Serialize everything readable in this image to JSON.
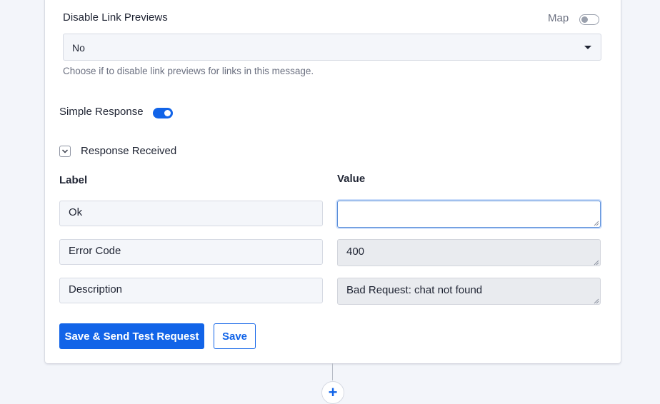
{
  "disable_link_previews": {
    "title": "Disable Link Previews",
    "map_label": "Map",
    "map_toggle_on": false,
    "selected": "No",
    "help": "Choose if to disable link previews for links in this message."
  },
  "simple_response": {
    "label": "Simple Response",
    "toggle_on": true
  },
  "response_received": {
    "label": "Response Received",
    "expanded": true
  },
  "table": {
    "label_header": "Label",
    "value_header": "Value",
    "rows": [
      {
        "label": "Ok",
        "value": ""
      },
      {
        "label": "Error Code",
        "value": "400"
      },
      {
        "label": "Description",
        "value": "Bad Request: chat not found"
      }
    ]
  },
  "actions": {
    "save_and_send": "Save & Send Test Request",
    "save": "Save"
  },
  "add_step": {
    "icon": "plus-icon",
    "glyph": "+"
  },
  "colors": {
    "accent": "#1264e8",
    "page_bg": "#f3f5fa"
  }
}
